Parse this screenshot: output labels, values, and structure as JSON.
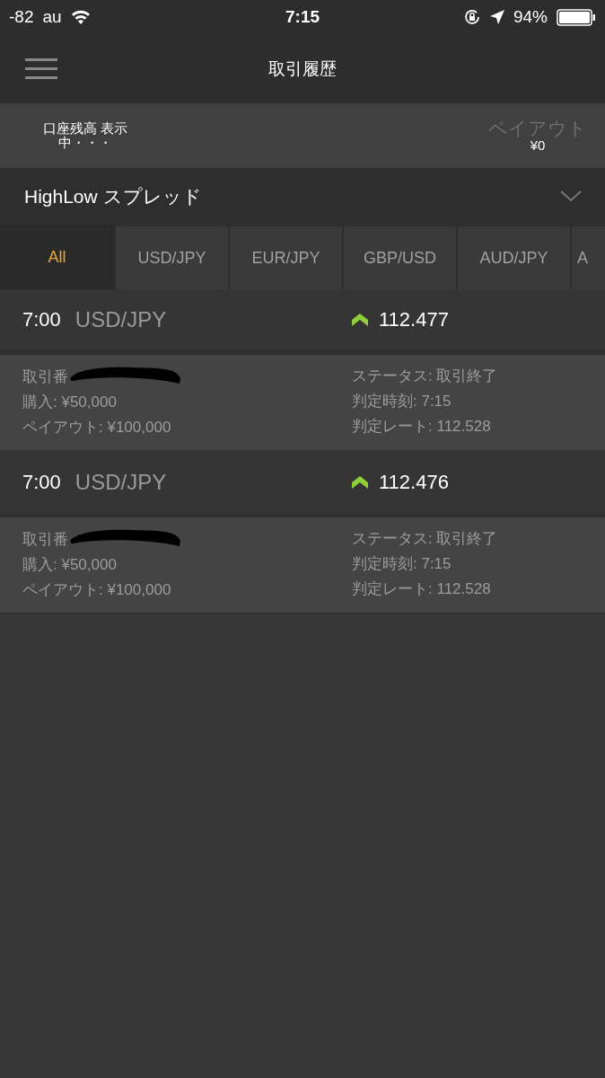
{
  "status_bar": {
    "signal": "-82",
    "carrier": "au",
    "time": "7:15",
    "battery": "94%"
  },
  "nav": {
    "title": "取引履歴"
  },
  "balance": {
    "label": "口座残高 表示",
    "value": "中・・・",
    "payout_label": "ペイアウト",
    "payout_value": "¥0"
  },
  "dropdown": {
    "label": "HighLow スプレッド"
  },
  "tabs": [
    {
      "label": "All",
      "selected": true
    },
    {
      "label": "USD/JPY",
      "selected": false
    },
    {
      "label": "EUR/JPY",
      "selected": false
    },
    {
      "label": "GBP/USD",
      "selected": false
    },
    {
      "label": "AUD/JPY",
      "selected": false
    },
    {
      "label": "A",
      "selected": false
    }
  ],
  "trades": [
    {
      "time": "7:00",
      "pair": "USD/JPY",
      "kind": "high",
      "rate": "112.477",
      "trade_no": "取引番",
      "purchase": "購入: ¥50,000",
      "payout": "ペイアウト: ¥100,000",
      "status": "ステータス: 取引終了",
      "judge_time": "判定時刻: 7:15",
      "judge_rate": "判定レート: 112.528"
    },
    {
      "time": "7:00",
      "pair": "USD/JPY",
      "kind": "high",
      "rate": "112.476",
      "trade_no": "取引番",
      "purchase": "購入: ¥50,000",
      "payout": "ペイアウト: ¥100,000",
      "status": "ステータス: 取引終了",
      "judge_time": "判定時刻: 7:15",
      "judge_rate": "判定レート: 112.528"
    }
  ]
}
